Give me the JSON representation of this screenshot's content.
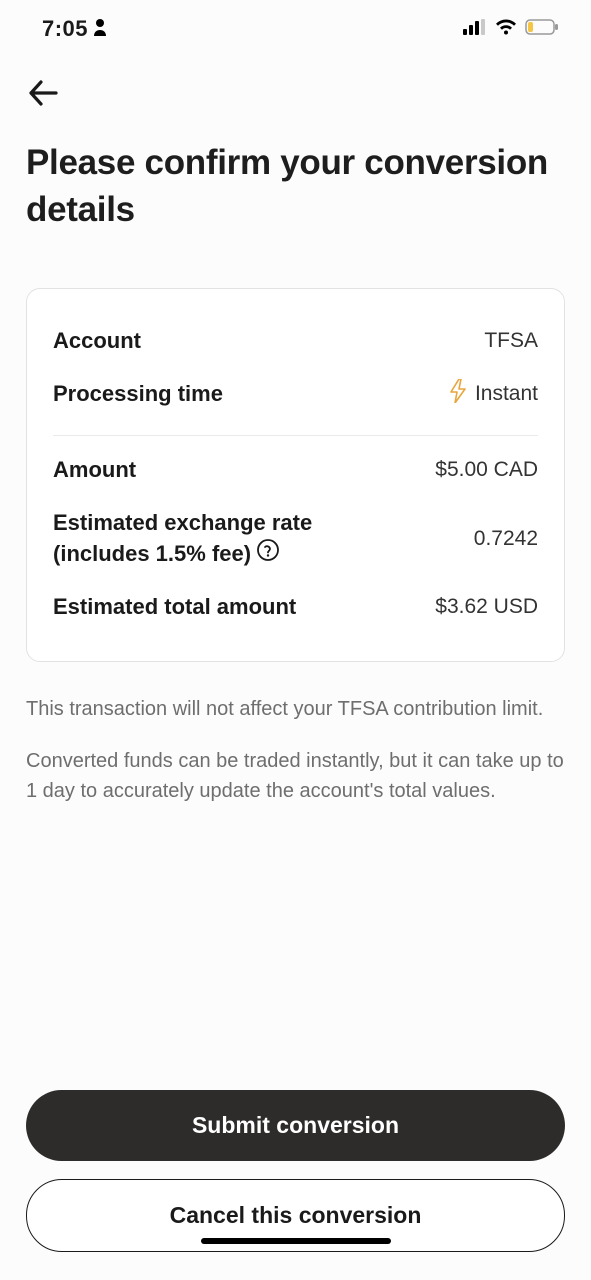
{
  "status": {
    "time": "7:05"
  },
  "page": {
    "title": "Please confirm your conversion details"
  },
  "card": {
    "account": {
      "label": "Account",
      "value": "TFSA"
    },
    "processing": {
      "label": "Processing time",
      "value": "Instant"
    },
    "amount": {
      "label": "Amount",
      "value": "$5.00 CAD"
    },
    "rate": {
      "label_line1": "Estimated exchange rate",
      "label_line2": "(includes 1.5% fee)",
      "value": "0.7242"
    },
    "total": {
      "label": "Estimated total amount",
      "value": "$3.62 USD"
    }
  },
  "disclaimers": {
    "d1": "This transaction will not affect your TFSA contribution limit.",
    "d2": "Converted funds can be traded instantly, but it can take up to 1 day to accurately update the account's total values."
  },
  "buttons": {
    "submit": "Submit conversion",
    "cancel": "Cancel this conversion"
  }
}
